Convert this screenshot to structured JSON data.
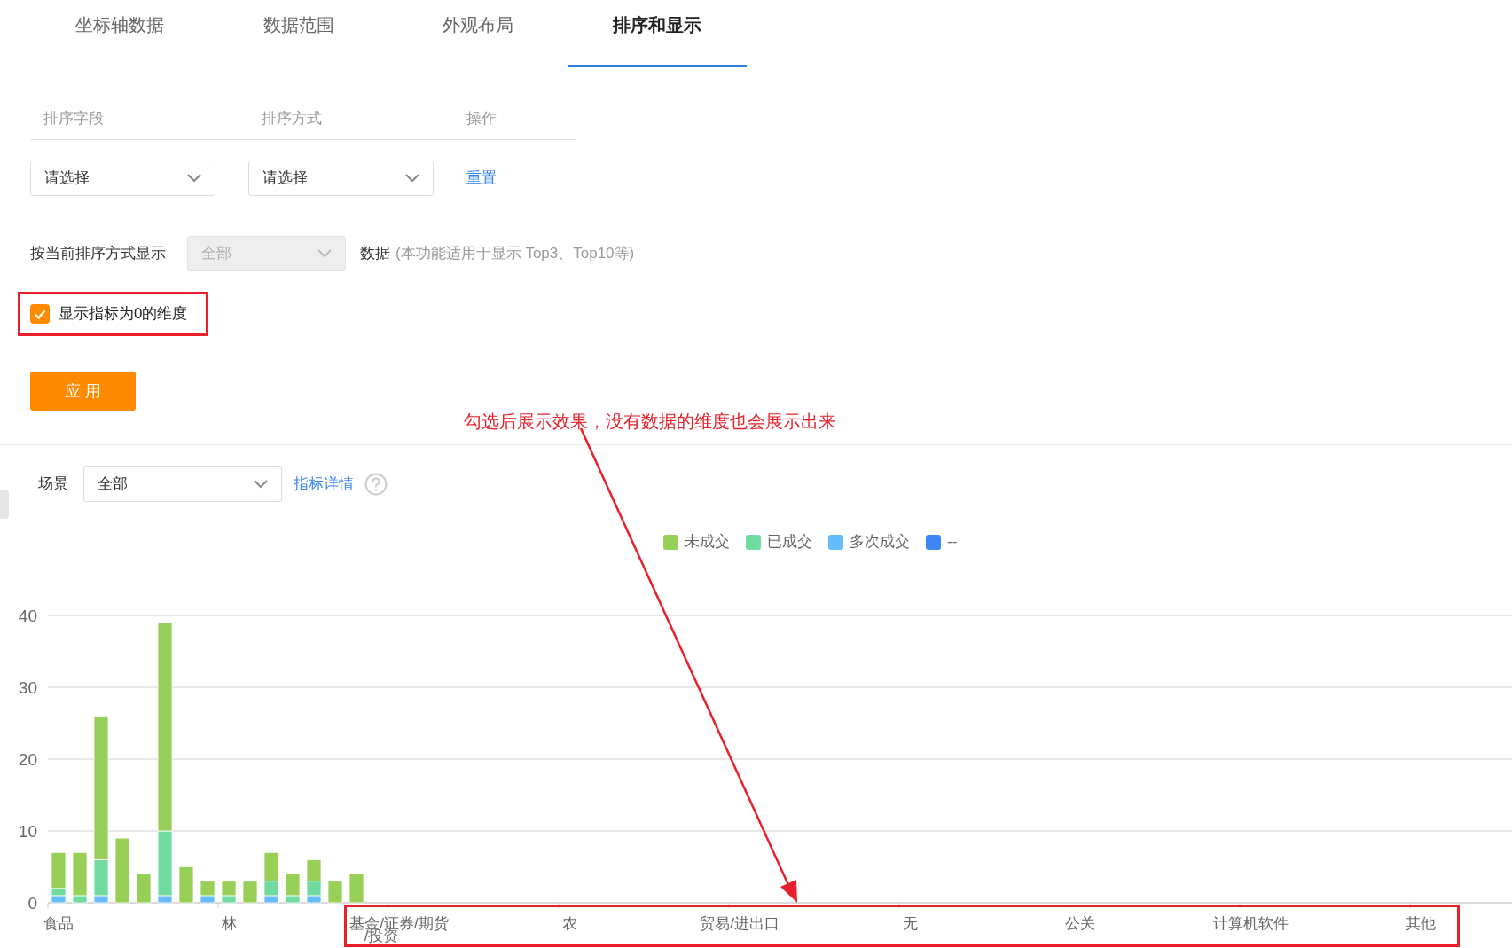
{
  "tabs": [
    {
      "label": "坐标轴数据",
      "selected": false
    },
    {
      "label": "数据范围",
      "selected": false
    },
    {
      "label": "外观布局",
      "selected": false
    },
    {
      "label": "排序和显示",
      "selected": true
    }
  ],
  "sort_table": {
    "columns": [
      "排序字段",
      "排序方式",
      "操作"
    ],
    "field_select": {
      "value": "请选择"
    },
    "order_select": {
      "value": "请选择"
    },
    "reset_link": "重置"
  },
  "display_row": {
    "label": "按当前排序方式显示",
    "select": {
      "value": "全部",
      "disabled": true
    },
    "suffix": "数据",
    "note": "(本功能适用于显示 Top3、Top10等)"
  },
  "show_zero_checkbox": {
    "label": "显示指标为0的维度",
    "checked": true
  },
  "apply_button": "应用",
  "annotation": {
    "text": "勾选后展示效果，没有数据的维度也会展示出来"
  },
  "scene": {
    "label": "场景",
    "select": {
      "value": "全部"
    },
    "detail_link": "指标详情"
  },
  "chart_data": {
    "type": "bar",
    "stacked": true,
    "grid": true,
    "legend": "top",
    "ylim": [
      0,
      40
    ],
    "yticks": [
      0,
      10,
      20,
      30,
      40
    ],
    "categories": [
      "食品",
      null,
      null,
      null,
      null,
      null,
      null,
      null,
      "林",
      null,
      null,
      null,
      null,
      null,
      null,
      null,
      "基金/证券/期货/投资",
      null,
      null,
      null,
      null,
      null,
      null,
      null,
      "农",
      null,
      null,
      null,
      null,
      null,
      null,
      null,
      "贸易/进出口",
      null,
      null,
      null,
      null,
      null,
      null,
      null,
      "无",
      null,
      null,
      null,
      null,
      null,
      null,
      null,
      "公关",
      null,
      null,
      null,
      null,
      null,
      null,
      null,
      "计算机软件",
      null,
      null,
      null,
      null,
      null,
      null,
      null,
      "其他",
      null,
      null,
      null,
      null
    ],
    "series": [
      {
        "name": "--",
        "color": "#3d86f5",
        "values": [
          0,
          0,
          0,
          0,
          0,
          0,
          0,
          0,
          0,
          0,
          0,
          0,
          0,
          0,
          0,
          0,
          0,
          0,
          0,
          0,
          0,
          0,
          0,
          0,
          0,
          0,
          0,
          0,
          0,
          0,
          0,
          0,
          0,
          0,
          0,
          0,
          0,
          0,
          0,
          0,
          0,
          0,
          0,
          0,
          0,
          0,
          0,
          0,
          0,
          0,
          0,
          0,
          0,
          0,
          0,
          0,
          0,
          0,
          0,
          0,
          0,
          0,
          0,
          0,
          0,
          0,
          0,
          0,
          0
        ]
      },
      {
        "name": "多次成交",
        "color": "#66bdfb",
        "values": [
          1,
          0,
          1,
          0,
          0,
          1,
          0,
          1,
          0,
          0,
          1,
          0,
          1,
          0,
          0,
          0,
          0,
          0,
          0,
          0,
          0,
          0,
          0,
          0,
          0,
          0,
          0,
          0,
          0,
          0,
          0,
          0,
          0,
          0,
          0,
          0,
          0,
          0,
          0,
          0,
          0,
          0,
          0,
          0,
          0,
          0,
          0,
          0,
          0,
          0,
          0,
          0,
          0,
          0,
          0,
          0,
          0,
          0,
          0,
          0,
          0,
          0,
          0,
          0,
          0,
          0,
          0,
          0,
          0
        ]
      },
      {
        "name": "已成交",
        "color": "#6fdb9e",
        "values": [
          1,
          1,
          5,
          0,
          0,
          9,
          0,
          0,
          1,
          0,
          2,
          1,
          2,
          0,
          0,
          0,
          0,
          0,
          0,
          0,
          0,
          0,
          0,
          0,
          0,
          0,
          0,
          0,
          0,
          0,
          0,
          0,
          0,
          0,
          0,
          0,
          0,
          0,
          0,
          0,
          0,
          0,
          0,
          0,
          0,
          0,
          0,
          0,
          0,
          0,
          0,
          0,
          0,
          0,
          0,
          0,
          0,
          0,
          0,
          0,
          0,
          0,
          0,
          0,
          0,
          0,
          0,
          0,
          0
        ]
      },
      {
        "name": "未成交",
        "color": "#97cf57",
        "values": [
          5,
          6,
          20,
          9,
          4,
          29,
          5,
          2,
          2,
          3,
          4,
          3,
          3,
          3,
          4,
          0,
          0,
          0,
          0,
          0,
          0,
          0,
          0,
          0,
          0,
          0,
          0,
          0,
          0,
          0,
          0,
          0,
          0,
          0,
          0,
          0,
          0,
          0,
          0,
          0,
          0,
          0,
          0,
          0,
          0,
          0,
          0,
          0,
          0,
          0,
          0,
          0,
          0,
          0,
          0,
          0,
          0,
          0,
          0,
          0,
          0,
          0,
          0,
          0,
          0,
          0,
          0,
          0,
          0
        ]
      }
    ]
  }
}
